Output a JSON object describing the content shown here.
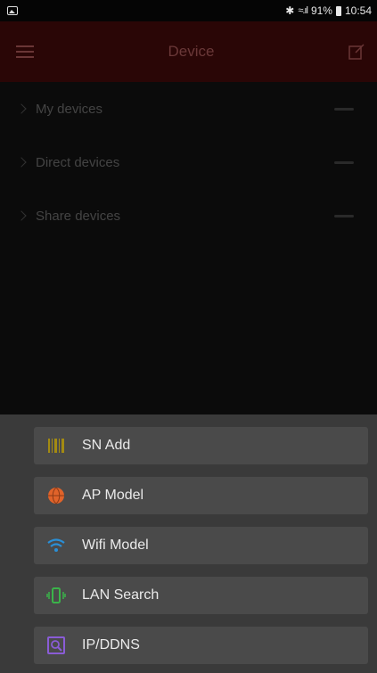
{
  "status_bar": {
    "battery": "91%",
    "time": "10:54"
  },
  "header": {
    "title": "Device"
  },
  "device_list": [
    {
      "label": "My devices"
    },
    {
      "label": "Direct devices"
    },
    {
      "label": "Share devices"
    }
  ],
  "action_sheet": {
    "items": [
      {
        "label": "SN Add",
        "icon": "barcode-icon"
      },
      {
        "label": "AP Model",
        "icon": "globe-icon"
      },
      {
        "label": "Wifi Model",
        "icon": "wifi-icon"
      },
      {
        "label": "LAN Search",
        "icon": "vibrate-phone-icon"
      },
      {
        "label": "IP/DDNS",
        "icon": "ip-search-icon"
      }
    ]
  },
  "colors": {
    "header_bg": "#2a0606",
    "sheet_bg": "#3a3a3a",
    "item_bg": "#4a4a4a",
    "barcode": "#a38a12",
    "globe": "#e0632a",
    "wifi": "#2a8fd6",
    "lan": "#3bb34a",
    "ip": "#8a5cd6"
  }
}
